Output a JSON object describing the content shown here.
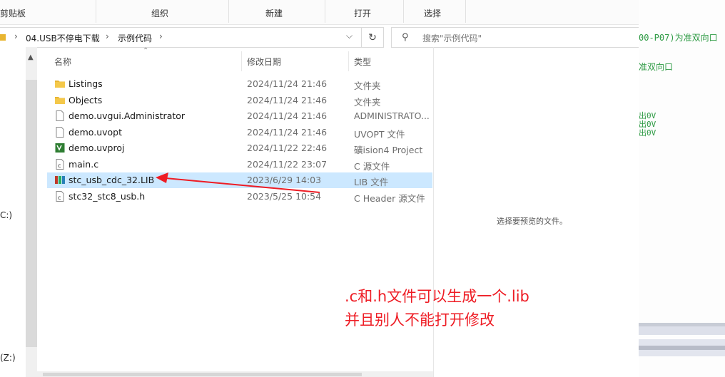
{
  "ribbon": {
    "groups": [
      "剪贴板",
      "组织",
      "新建",
      "打开",
      "选择"
    ]
  },
  "address": {
    "crumbs": [
      "04.USB不停电下载",
      "示例代码"
    ],
    "search_placeholder": "搜索\"示例代码\""
  },
  "nav": {
    "items": [
      "C:)",
      "(Z:)"
    ]
  },
  "columns": {
    "name": "名称",
    "date": "修改日期",
    "type": "类型"
  },
  "files": [
    {
      "name": "Listings",
      "date": "2024/11/24 21:46",
      "type": "文件夹",
      "icon": "folder-icon"
    },
    {
      "name": "Objects",
      "date": "2024/11/24 21:46",
      "type": "文件夹",
      "icon": "folder-icon"
    },
    {
      "name": "demo.uvgui.Administrator",
      "date": "2024/11/24 21:46",
      "type": "ADMINISTRATO...",
      "icon": "file-icon"
    },
    {
      "name": "demo.uvopt",
      "date": "2024/11/24 21:46",
      "type": "UVOPT 文件",
      "icon": "file-icon"
    },
    {
      "name": "demo.uvproj",
      "date": "2024/11/22 22:46",
      "type": "礦ision4 Project",
      "icon": "keil-project-icon"
    },
    {
      "name": "main.c",
      "date": "2024/11/22 23:07",
      "type": "C 源文件",
      "icon": "c-file-icon"
    },
    {
      "name": "stc_usb_cdc_32.LIB",
      "date": "2023/6/29 14:03",
      "type": "LIB 文件",
      "icon": "lib-file-icon"
    },
    {
      "name": "stc32_stc8_usb.h",
      "date": "2023/5/25 10:54",
      "type": "C Header 源文件",
      "icon": "c-file-icon"
    }
  ],
  "selected_index": 6,
  "preview": {
    "message": "选择要预览的文件。"
  },
  "background_app": {
    "lines": [
      "00-P07)为准双向口",
      "准双向口",
      "出0V",
      "出0V",
      "出0V"
    ]
  },
  "annotation": {
    "line1": ".c和.h文件可以生成一个.lib",
    "line2": "并且别人不能打开修改",
    "color": "#ee1c24"
  }
}
